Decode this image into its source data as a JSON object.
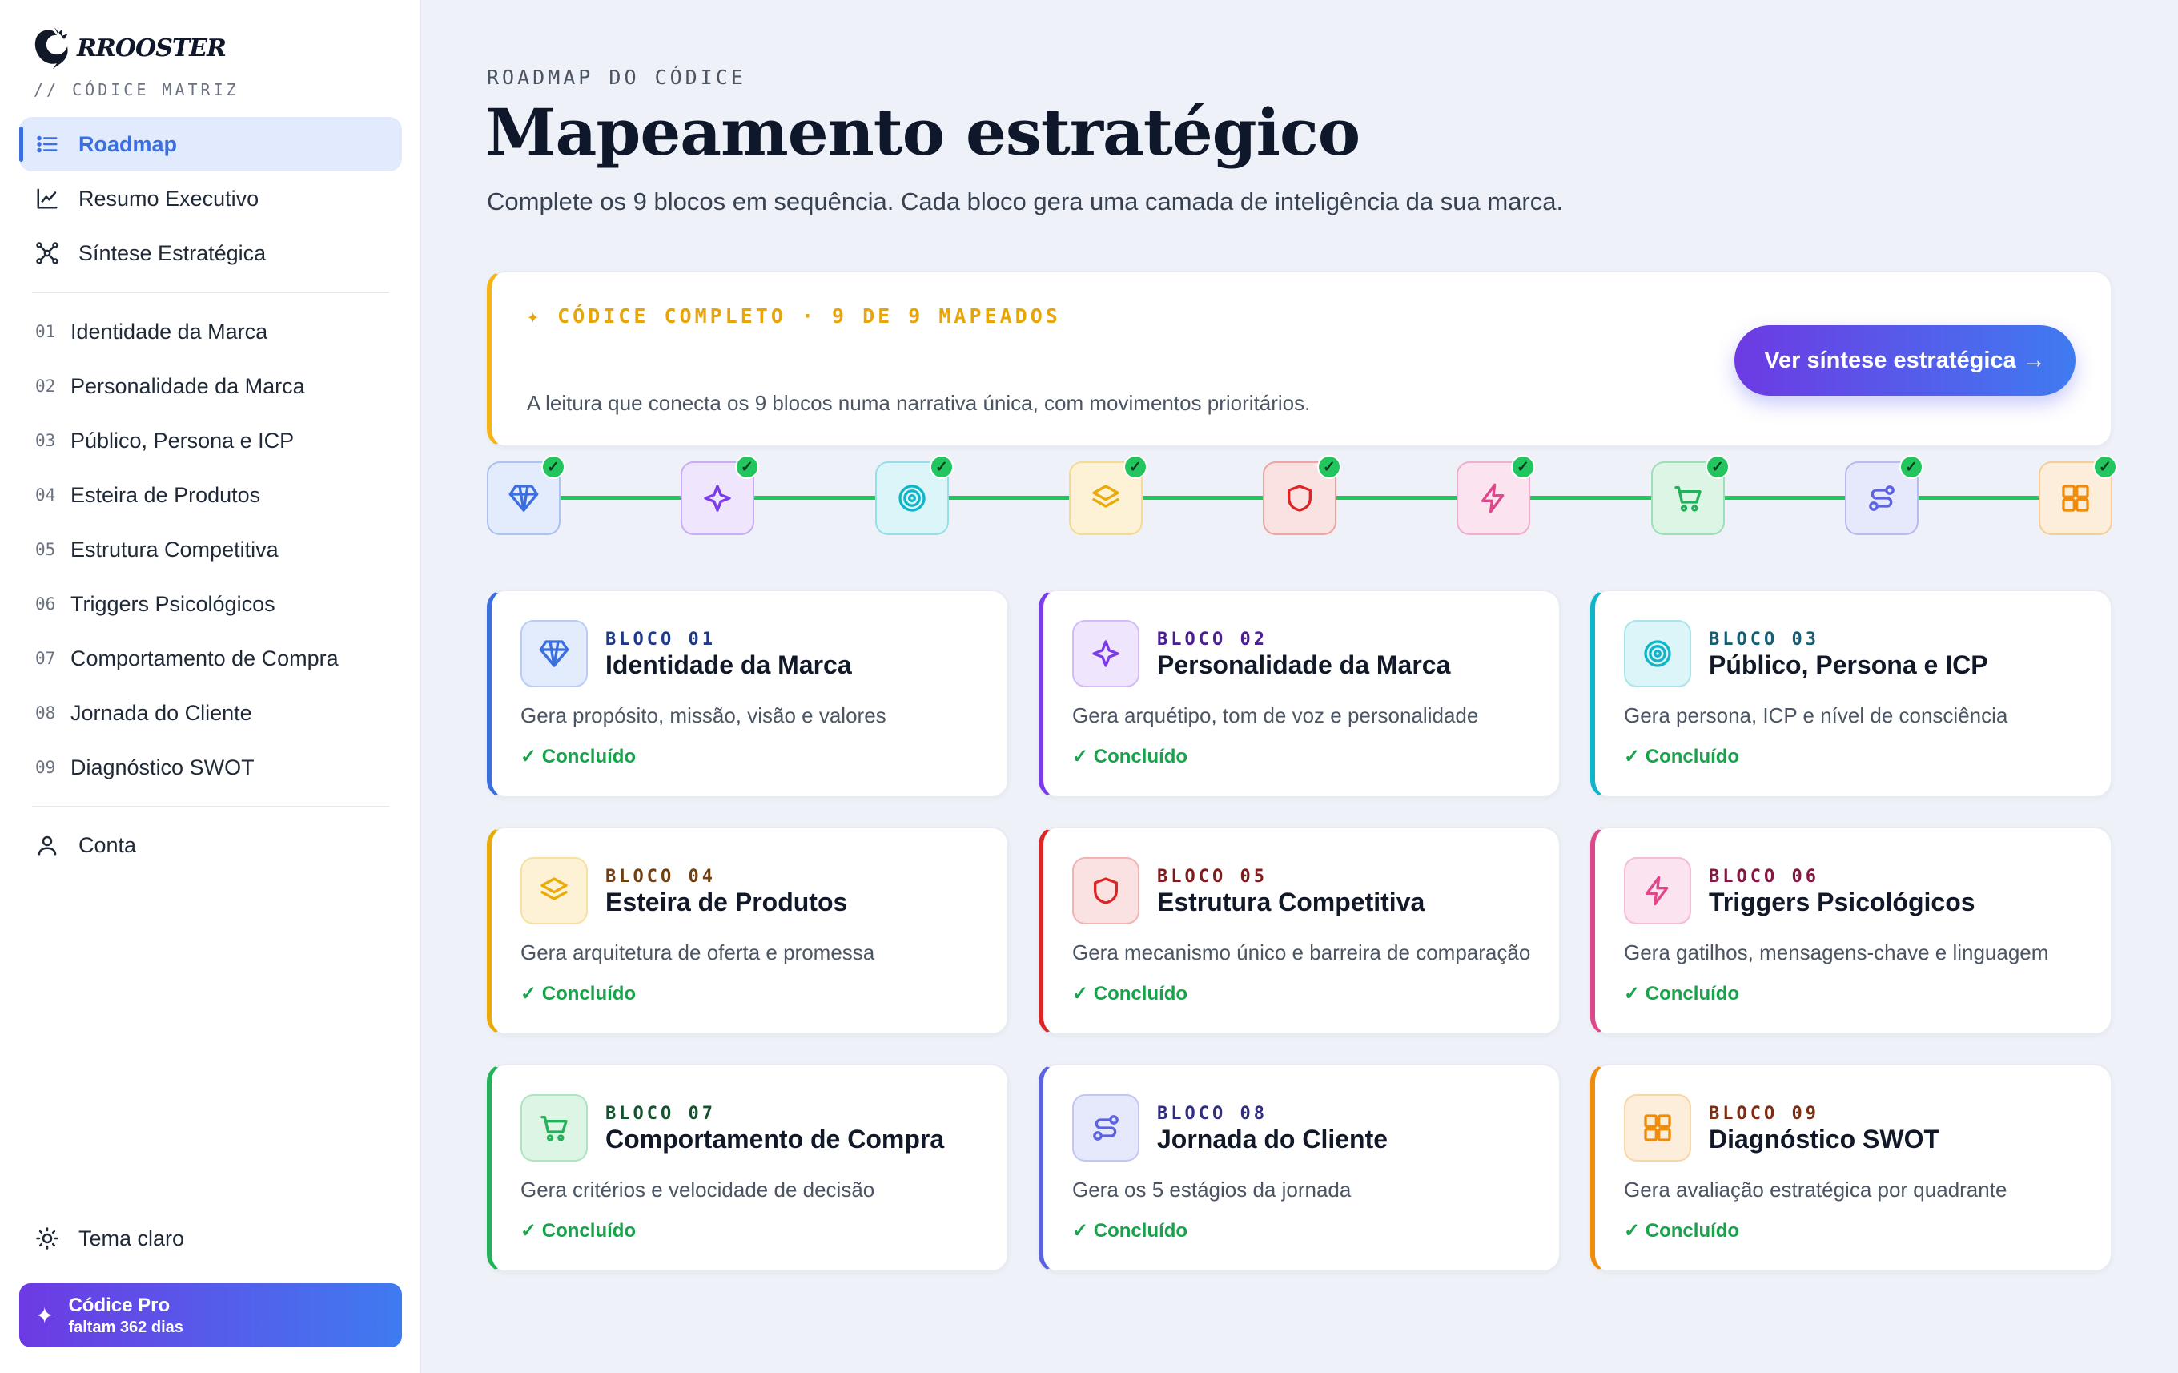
{
  "sidebar": {
    "brand_name": "RROOSTER",
    "brand_sub": "// CÓDICE MATRIZ",
    "main_nav": [
      {
        "label": "Roadmap",
        "icon": "list-icon",
        "active": true
      },
      {
        "label": "Resumo Executivo",
        "icon": "chart-line-icon"
      },
      {
        "label": "Síntese Estratégica",
        "icon": "network-icon"
      }
    ],
    "blocks": [
      {
        "num": "01",
        "label": "Identidade da Marca"
      },
      {
        "num": "02",
        "label": "Personalidade da Marca"
      },
      {
        "num": "03",
        "label": "Público, Persona e ICP"
      },
      {
        "num": "04",
        "label": "Esteira de Produtos"
      },
      {
        "num": "05",
        "label": "Estrutura Competitiva"
      },
      {
        "num": "06",
        "label": "Triggers Psicológicos"
      },
      {
        "num": "07",
        "label": "Comportamento de Compra"
      },
      {
        "num": "08",
        "label": "Jornada do Cliente"
      },
      {
        "num": "09",
        "label": "Diagnóstico SWOT"
      }
    ],
    "account_label": "Conta",
    "theme_label": "Tema claro",
    "pro": {
      "title": "Códice Pro",
      "subtitle": "faltam 362 dias"
    }
  },
  "header": {
    "eyebrow": "ROADMAP DO CÓDICE",
    "title": "Mapeamento estratégico",
    "subtitle": "Complete os 9 blocos em sequência. Cada bloco gera uma camada de inteligência da sua marca."
  },
  "hero": {
    "tag": "✦ CÓDICE COMPLETO · 9 DE 9 MAPEADOS",
    "description": "A leitura que conecta os 9 blocos numa narrativa única, com movimentos prioritários.",
    "button_label": "Ver síntese estratégica →",
    "accent": "#f5b316"
  },
  "timeline_check": "✓",
  "cards": [
    {
      "bloco": "BLOCO 01",
      "title": "Identidade da Marca",
      "desc": "Gera propósito, missão, visão e valores",
      "status": "✓ Concluído",
      "icon": "diamond-icon",
      "color": "#3b6fe0",
      "bg": "#e3ecfd",
      "label_color": "#1e3a8a"
    },
    {
      "bloco": "BLOCO 02",
      "title": "Personalidade da Marca",
      "desc": "Gera arquétipo, tom de voz e personalidade",
      "status": "✓ Concluído",
      "icon": "sparkle-icon",
      "color": "#7c3aed",
      "bg": "#efe6fd",
      "label_color": "#4c1d95"
    },
    {
      "bloco": "BLOCO 03",
      "title": "Público, Persona e ICP",
      "desc": "Gera persona, ICP e nível de consciência",
      "status": "✓ Concluído",
      "icon": "target-icon",
      "color": "#0fb5c9",
      "bg": "#dcf5f8",
      "label_color": "#155e75"
    },
    {
      "bloco": "BLOCO 04",
      "title": "Esteira de Produtos",
      "desc": "Gera arquitetura de oferta e promessa",
      "status": "✓ Concluído",
      "icon": "layers-icon",
      "color": "#eaaa08",
      "bg": "#fdf2d6",
      "label_color": "#713f12"
    },
    {
      "bloco": "BLOCO 05",
      "title": "Estrutura Competitiva",
      "desc": "Gera mecanismo único e barreira de comparação",
      "status": "✓ Concluído",
      "icon": "shield-icon",
      "color": "#dc2626",
      "bg": "#fbe2e2",
      "label_color": "#7f1d1d"
    },
    {
      "bloco": "BLOCO 06",
      "title": "Triggers Psicológicos",
      "desc": "Gera gatilhos, mensagens-chave e linguagem",
      "status": "✓ Concluído",
      "icon": "bolt-icon",
      "color": "#e0468a",
      "bg": "#fbe3ef",
      "label_color": "#831843"
    },
    {
      "bloco": "BLOCO 07",
      "title": "Comportamento de Compra",
      "desc": "Gera critérios e velocidade de decisão",
      "status": "✓ Concluído",
      "icon": "cart-icon",
      "color": "#22b35a",
      "bg": "#dcf5e4",
      "label_color": "#14532d"
    },
    {
      "bloco": "BLOCO 08",
      "title": "Jornada do Cliente",
      "desc": "Gera os 5 estágios da jornada",
      "status": "✓ Concluído",
      "icon": "route-icon",
      "color": "#5b63e0",
      "bg": "#e6e8fb",
      "label_color": "#312e81"
    },
    {
      "bloco": "BLOCO 09",
      "title": "Diagnóstico SWOT",
      "desc": "Gera avaliação estratégica por quadrante",
      "status": "✓ Concluído",
      "icon": "grid-icon",
      "color": "#f08c0a",
      "bg": "#fdeedb",
      "label_color": "#7c2d12"
    }
  ]
}
